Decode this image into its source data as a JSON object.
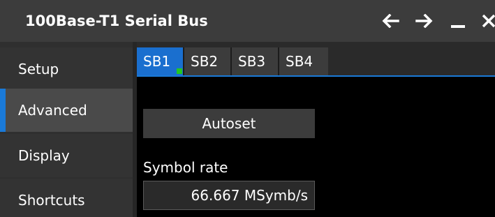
{
  "window": {
    "title": "100Base-T1 Serial Bus",
    "controls": [
      "arrow-left-icon",
      "arrow-right-icon",
      "minimize-icon",
      "close-icon"
    ]
  },
  "sidebar": {
    "items": [
      {
        "label": "Setup",
        "active": false
      },
      {
        "label": "Advanced",
        "active": true
      },
      {
        "label": "Display",
        "active": false
      },
      {
        "label": "Shortcuts",
        "active": false
      }
    ]
  },
  "tabs": [
    {
      "label": "SB1",
      "active": true,
      "indicator": true
    },
    {
      "label": "SB2",
      "active": false
    },
    {
      "label": "SB3",
      "active": false
    },
    {
      "label": "SB4",
      "active": false
    }
  ],
  "main": {
    "autoset_label": "Autoset",
    "symbol_rate_label": "Symbol rate",
    "symbol_rate_value": "66.667 MSymb/s"
  },
  "colors": {
    "accent": "#1a7ad8",
    "indicator": "#23c823",
    "titlebar": "#3c3c3c"
  }
}
